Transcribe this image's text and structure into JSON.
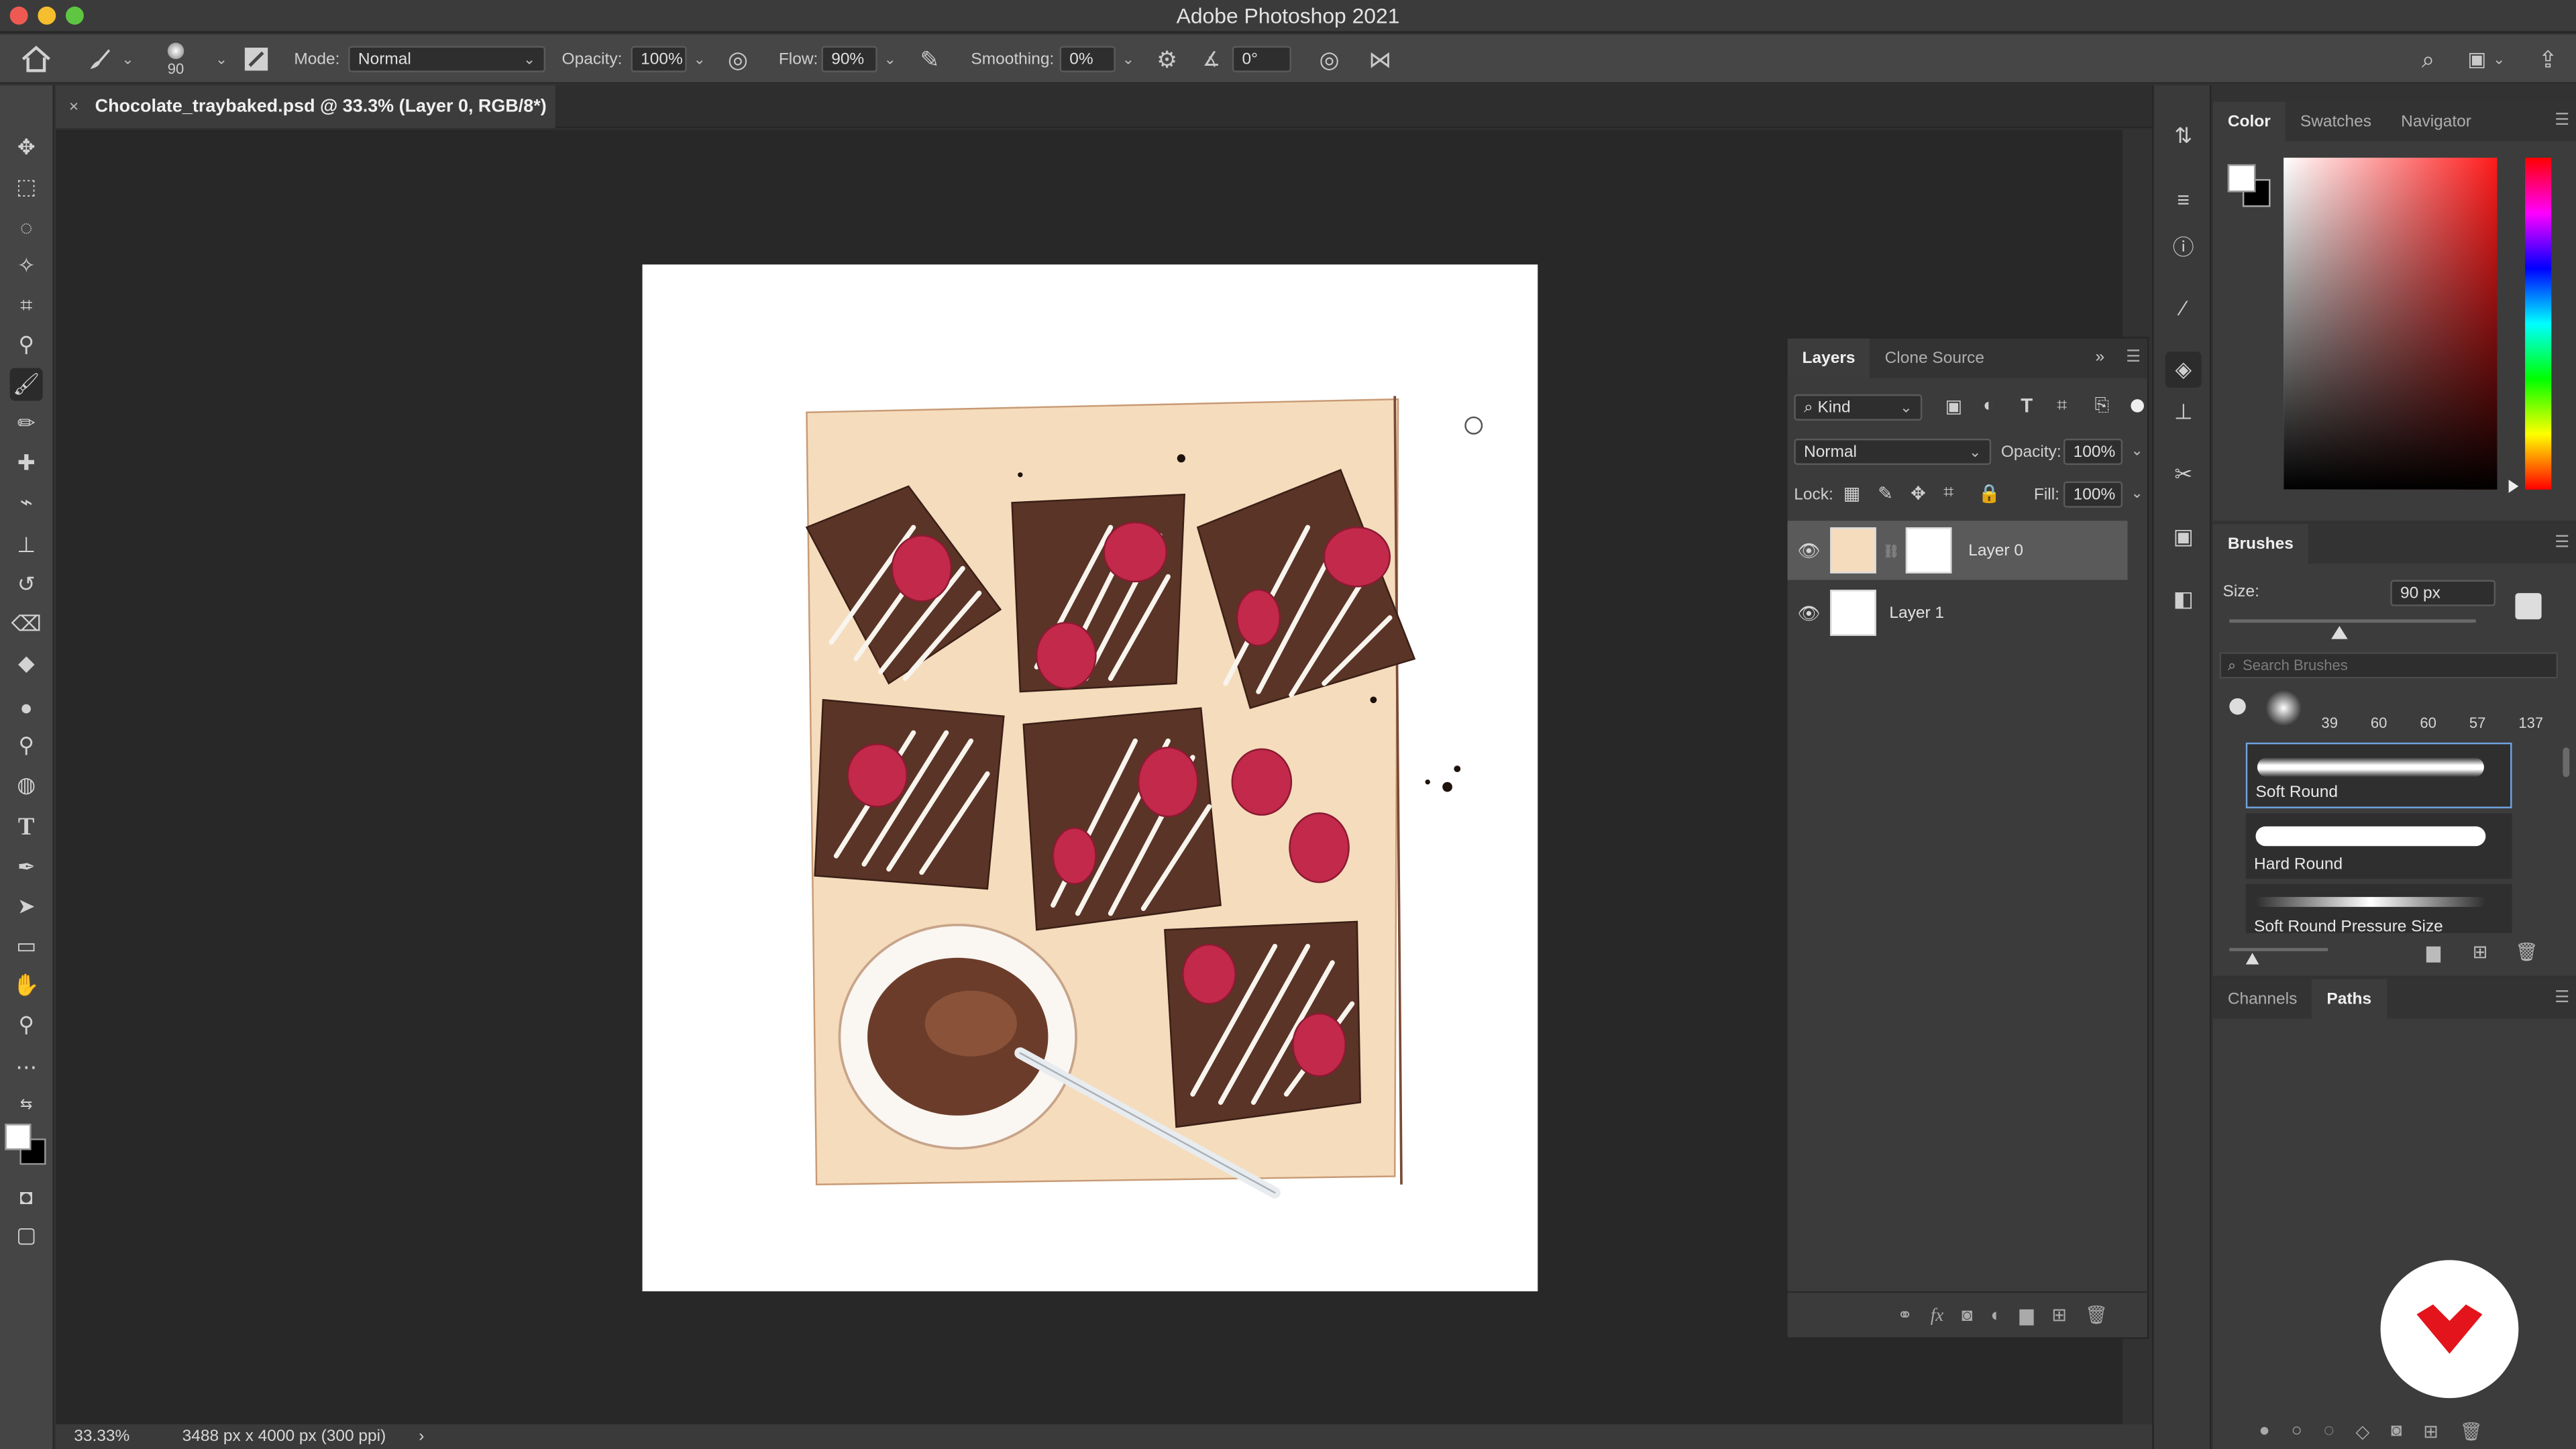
{
  "app": {
    "title": "Adobe Photoshop 2021"
  },
  "options_bar": {
    "brush_size": "90",
    "mode_label": "Mode:",
    "mode_value": "Normal",
    "opacity_label": "Opacity:",
    "opacity_value": "100%",
    "flow_label": "Flow:",
    "flow_value": "90%",
    "smoothing_label": "Smoothing:",
    "smoothing_value": "0%",
    "angle_value": "0°"
  },
  "document": {
    "tab_label": "Chocolate_traybaked.psd @ 33.3% (Layer 0, RGB/8*)",
    "close_glyph": "×"
  },
  "status_bar": {
    "zoom": "33.33%",
    "dimensions": "3488 px x 4000 px (300 ppi)",
    "arrow": "›"
  },
  "color_panel": {
    "tabs": [
      "Color",
      "Swatches",
      "Navigator"
    ],
    "hue_marker": 1
  },
  "layers_panel": {
    "tabs": [
      "Layers",
      "Clone Source"
    ],
    "kind_label": "Kind",
    "blend_mode": "Normal",
    "opacity_label": "Opacity:",
    "opacity_value": "100%",
    "lock_label": "Lock:",
    "fill_label": "Fill:",
    "fill_value": "100%",
    "layers": [
      {
        "name": "Layer 0",
        "selected": true
      },
      {
        "name": "Layer 1",
        "selected": false
      }
    ]
  },
  "brushes_panel": {
    "title": "Brushes",
    "size_label": "Size:",
    "size_value": "90 px",
    "size_slider": 0.45,
    "search_placeholder": "Search Brushes",
    "recent_sizes": [
      "39",
      "60",
      "60",
      "57",
      "137"
    ],
    "presets": [
      {
        "name": "Soft Round",
        "selected": true
      },
      {
        "name": "Hard Round",
        "selected": false
      },
      {
        "name": "Soft Round Pressure Size",
        "selected": false
      }
    ]
  },
  "channels_panel": {
    "tabs": [
      "Channels",
      "Paths"
    ]
  },
  "colors": {
    "chocolate": "#5a3426",
    "raspberry": "#c2294a",
    "paper": "#f3d9b9",
    "badge_red": "#e3141b"
  }
}
